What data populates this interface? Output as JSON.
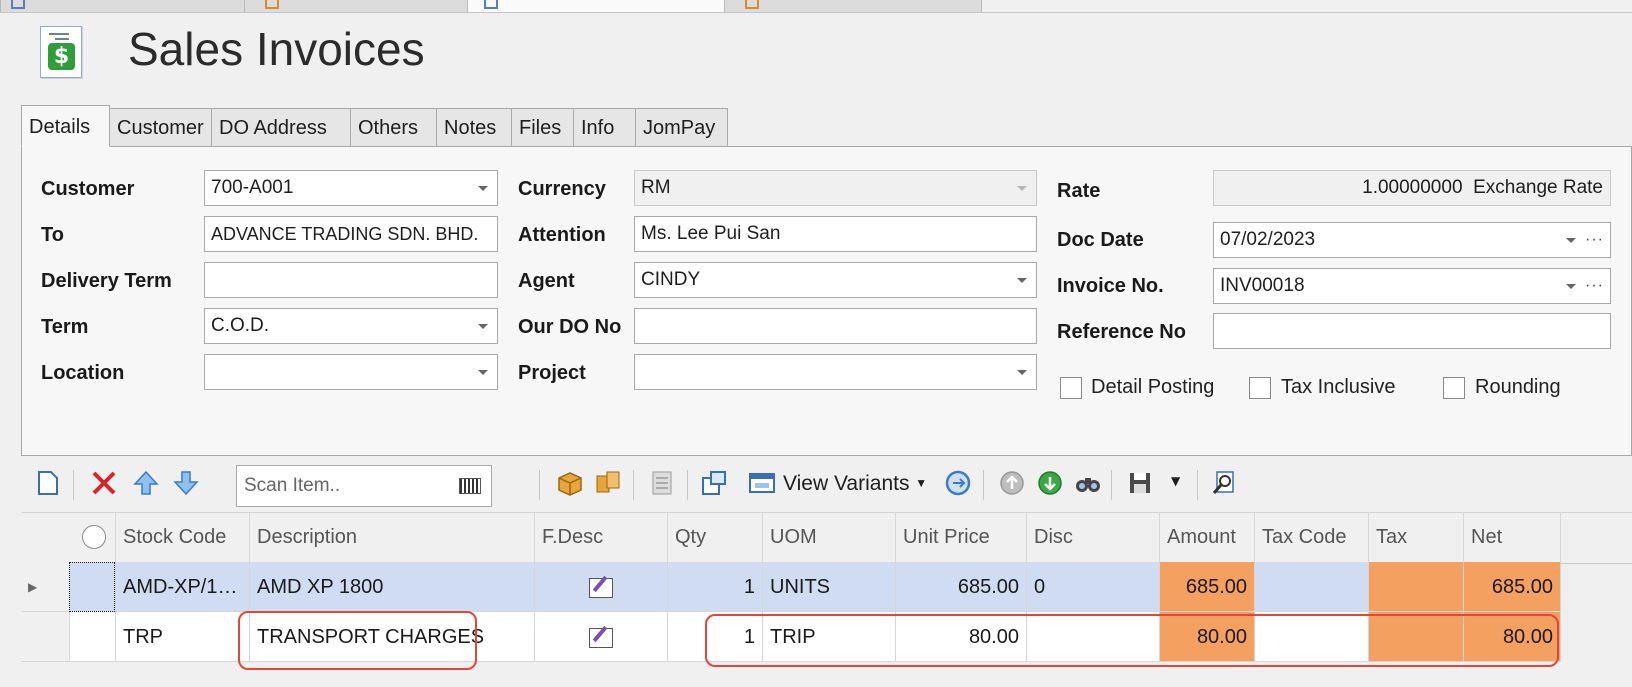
{
  "title": "Sales Invoices",
  "form_tabs": [
    "Details",
    "Customer",
    "DO Address",
    "Others",
    "Notes",
    "Files",
    "Info",
    "JomPay"
  ],
  "fields": {
    "customer_label": "Customer",
    "customer": "700-A001",
    "to_label": "To",
    "to": "ADVANCE TRADING SDN. BHD.",
    "delivery_term_label": "Delivery Term",
    "delivery_term": "",
    "term_label": "Term",
    "term": "C.O.D.",
    "location_label": "Location",
    "location": "",
    "currency_label": "Currency",
    "currency": "RM",
    "attention_label": "Attention",
    "attention": "Ms. Lee Pui San",
    "agent_label": "Agent",
    "agent": "CINDY",
    "our_do_label": "Our DO No",
    "our_do": "",
    "project_label": "Project",
    "project": "",
    "rate_label": "Rate",
    "rate": "1.00000000",
    "rate_suffix": "Exchange Rate",
    "doc_date_label": "Doc Date",
    "doc_date": "07/02/2023",
    "invoice_no_label": "Invoice No.",
    "invoice_no": "INV00018",
    "reference_label": "Reference No",
    "reference": ""
  },
  "checkboxes": {
    "detail_posting": "Detail Posting",
    "tax_inclusive": "Tax Inclusive",
    "rounding": "Rounding"
  },
  "toolbar": {
    "scan_placeholder": "Scan Item..",
    "view_variants": "View Variants"
  },
  "grid": {
    "columns": [
      "Stock Code",
      "Description",
      "F.Desc",
      "Qty",
      "UOM",
      "Unit Price",
      "Disc",
      "Amount",
      "Tax Code",
      "Tax",
      "Net"
    ],
    "rows": [
      {
        "stock_code": "AMD-XP/1…",
        "description": "AMD XP 1800",
        "qty": "1",
        "uom": "UNITS",
        "unit_price": "685.00",
        "disc": "0",
        "amount": "685.00",
        "tax_code": "",
        "tax": "",
        "net": "685.00"
      },
      {
        "stock_code": "TRP",
        "description": "TRANSPORT CHARGES",
        "qty": "1",
        "uom": "TRIP",
        "unit_price": "80.00",
        "disc": "",
        "amount": "80.00",
        "tax_code": "",
        "tax": "",
        "net": "80.00"
      }
    ]
  },
  "colors": {
    "accent_orange": "#f4a060",
    "highlight_red": "#e0473a",
    "selected_row": "#cfdcf2"
  }
}
